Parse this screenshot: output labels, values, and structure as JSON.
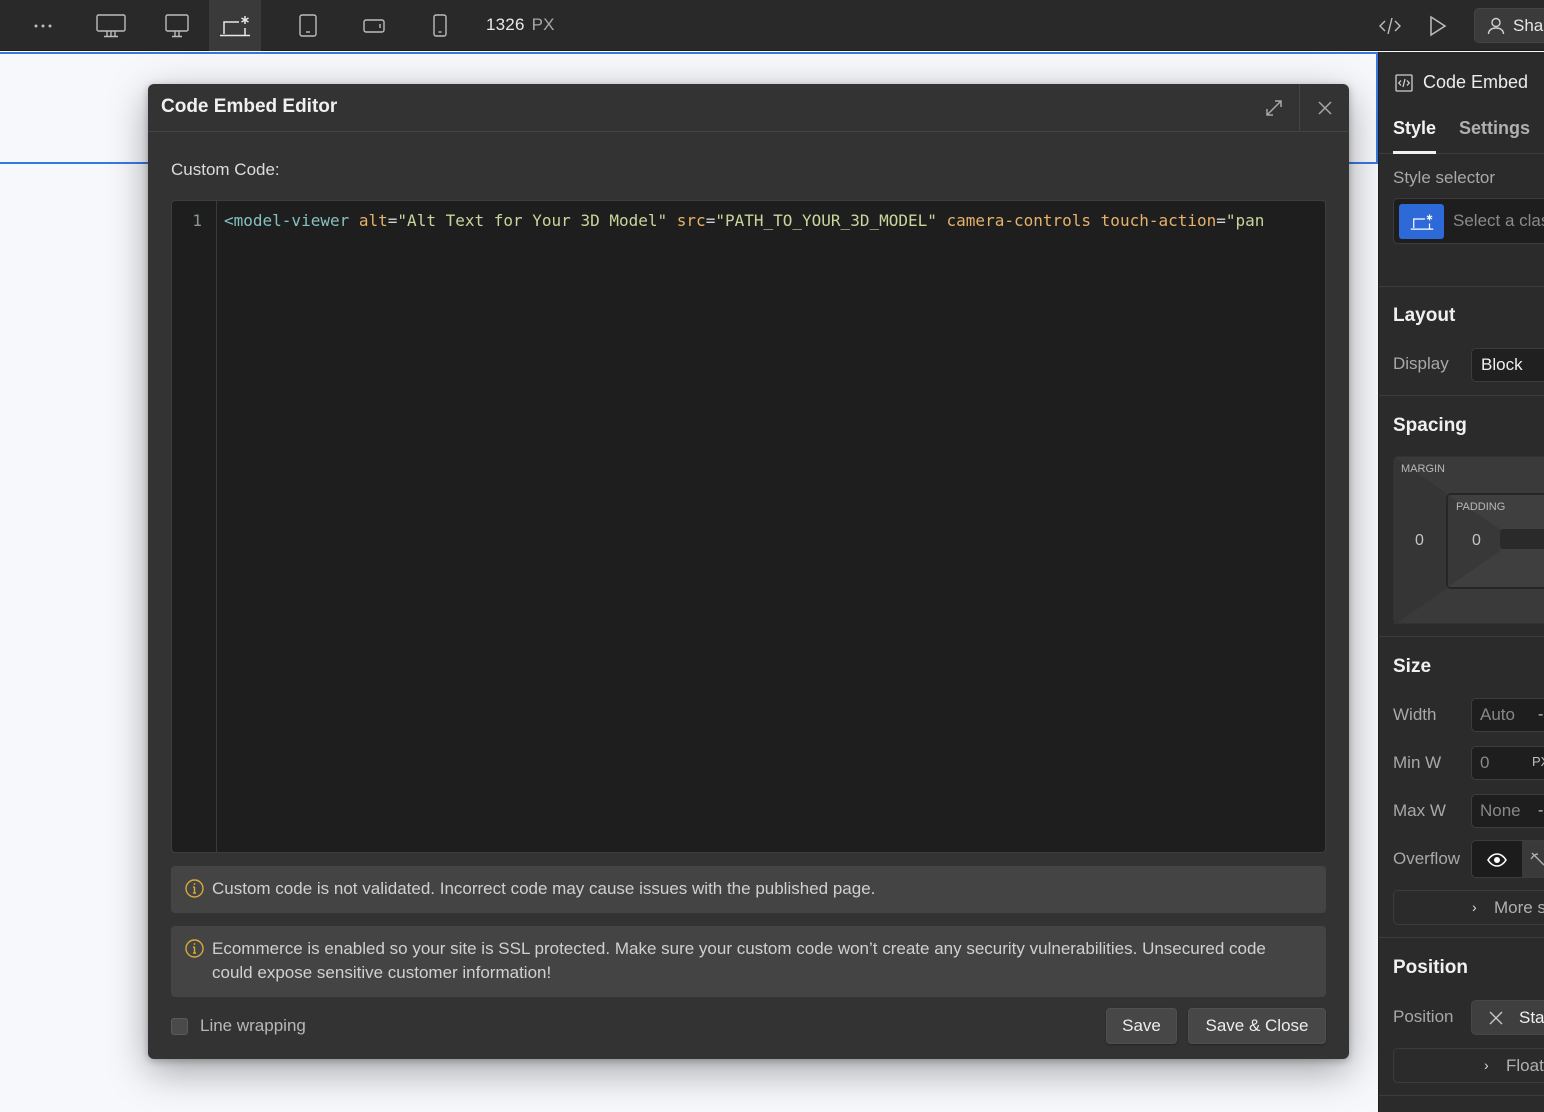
{
  "toolbar": {
    "more_icon": "ellipsis-icon",
    "breakpoints": [
      {
        "name": "desktop-xl",
        "icon": "monitor-large-icon",
        "active": false
      },
      {
        "name": "desktop-l",
        "icon": "monitor-icon",
        "active": false
      },
      {
        "name": "base",
        "icon": "laptop-star-icon",
        "active": true
      },
      {
        "name": "tablet",
        "icon": "tablet-icon",
        "active": false
      },
      {
        "name": "mobile-landscape",
        "icon": "phone-landscape-icon",
        "active": false
      },
      {
        "name": "mobile-portrait",
        "icon": "phone-portrait-icon",
        "active": false
      }
    ],
    "width_value": "1326",
    "width_unit": "PX",
    "code_icon": "code-icon",
    "preview_icon": "play-icon",
    "share_label": "Share"
  },
  "modal": {
    "title": "Code Embed Editor",
    "custom_code_label": "Custom Code:",
    "code": {
      "line_number": "1",
      "tokens": [
        {
          "type": "tag",
          "text": "<model-viewer"
        },
        {
          "type": "space",
          "text": " "
        },
        {
          "type": "attr",
          "text": "alt"
        },
        {
          "type": "eq",
          "text": "="
        },
        {
          "type": "str",
          "text": "\"Alt Text for Your 3D Model\""
        },
        {
          "type": "space",
          "text": " "
        },
        {
          "type": "attr",
          "text": "src"
        },
        {
          "type": "eq",
          "text": "="
        },
        {
          "type": "str",
          "text": "\"PATH_TO_YOUR_3D_MODEL\""
        },
        {
          "type": "space",
          "text": " "
        },
        {
          "type": "attr",
          "text": "camera-controls"
        },
        {
          "type": "space",
          "text": " "
        },
        {
          "type": "attr",
          "text": "touch-action"
        },
        {
          "type": "eq",
          "text": "="
        },
        {
          "type": "str",
          "text": "\"pan"
        }
      ]
    },
    "notices": [
      "Custom code is not validated. Incorrect code may cause issues with the published page.",
      "Ecommerce is enabled so your site is SSL protected. Make sure your custom code won’t create any security vulnerabilities. Unsecured code could expose sensitive customer information!"
    ],
    "line_wrapping_label": "Line wrapping",
    "line_wrapping_checked": false,
    "save_label": "Save",
    "save_close_label": "Save & Close"
  },
  "panel": {
    "element_name": "Code Embed",
    "tabs": [
      "Style",
      "Settings"
    ],
    "active_tab": "Style",
    "style_selector_label": "Style selector",
    "style_selector_placeholder": "Select a class",
    "layout": {
      "title": "Layout",
      "display_label": "Display",
      "display_value": "Block"
    },
    "spacing": {
      "title": "Spacing",
      "margin_label": "MARGIN",
      "padding_label": "PADDING",
      "margin_left": "0",
      "padding_left": "0"
    },
    "size": {
      "title": "Size",
      "width_label": "Width",
      "width_value": "Auto",
      "width_unit": "-",
      "min_w_label": "Min W",
      "min_w_value": "0",
      "min_w_unit": "PX",
      "max_w_label": "Max W",
      "max_w_value": "None",
      "max_w_unit": "-",
      "overflow_label": "Overflow",
      "more_label": "More size options"
    },
    "position": {
      "title": "Position",
      "position_label": "Position",
      "position_value": "Static",
      "float_label": "Float and clear"
    }
  },
  "colors": {
    "accent": "#3a78e0",
    "info_icon": "#d8a93a",
    "modal_bg": "#333333",
    "editor_bg": "#1e1e1e"
  }
}
